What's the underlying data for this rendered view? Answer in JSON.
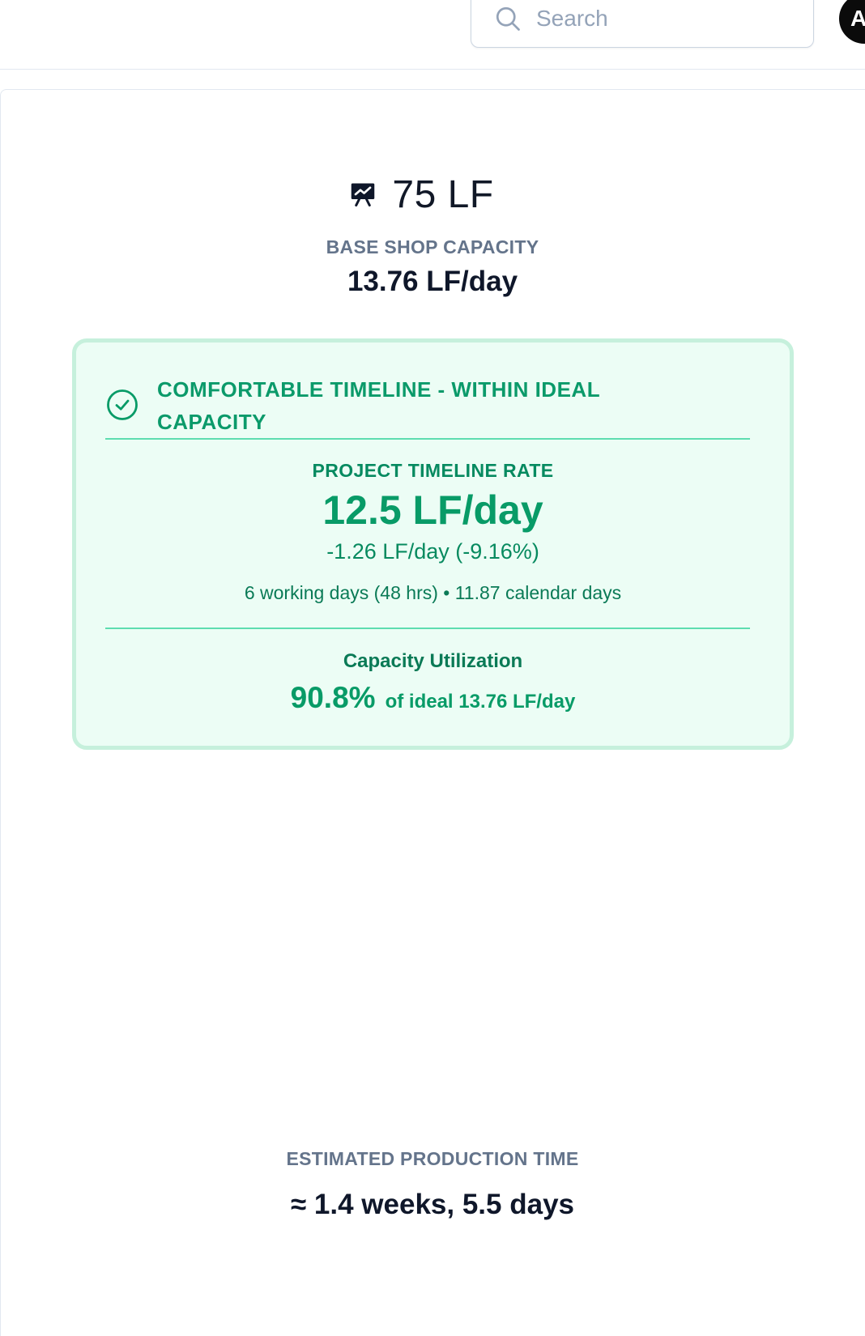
{
  "header": {
    "search": {
      "placeholder": "Search",
      "value": "",
      "icon": "search-icon"
    },
    "avatar_initial": "A"
  },
  "summary": {
    "total_icon": "presentation-chart-icon",
    "total_length": "75 LF",
    "base_capacity_label": "BASE SHOP CAPACITY",
    "base_capacity_value": "13.76 LF/day"
  },
  "status_card": {
    "icon": "check-circle-icon",
    "title": "COMFORTABLE TIMELINE - WITHIN IDEAL CAPACITY",
    "rate_label": "PROJECT TIMELINE RATE",
    "rate_value": "12.5 LF/day",
    "rate_difference": "-1.26 LF/day (-9.16%)",
    "duration": "6 working days (48 hrs) • 11.87 calendar days",
    "utilization_label": "Capacity Utilization",
    "utilization_percent": "90.8%",
    "utilization_reference": "of ideal 13.76 LF/day",
    "colors": {
      "background": "#ecfdf5",
      "border": "#c6f0dc",
      "divider": "#5eddb0",
      "accent": "#089b67"
    }
  },
  "estimate": {
    "label": "ESTIMATED PRODUCTION TIME",
    "value": "≈ 1.4 weeks, 5.5 days"
  }
}
